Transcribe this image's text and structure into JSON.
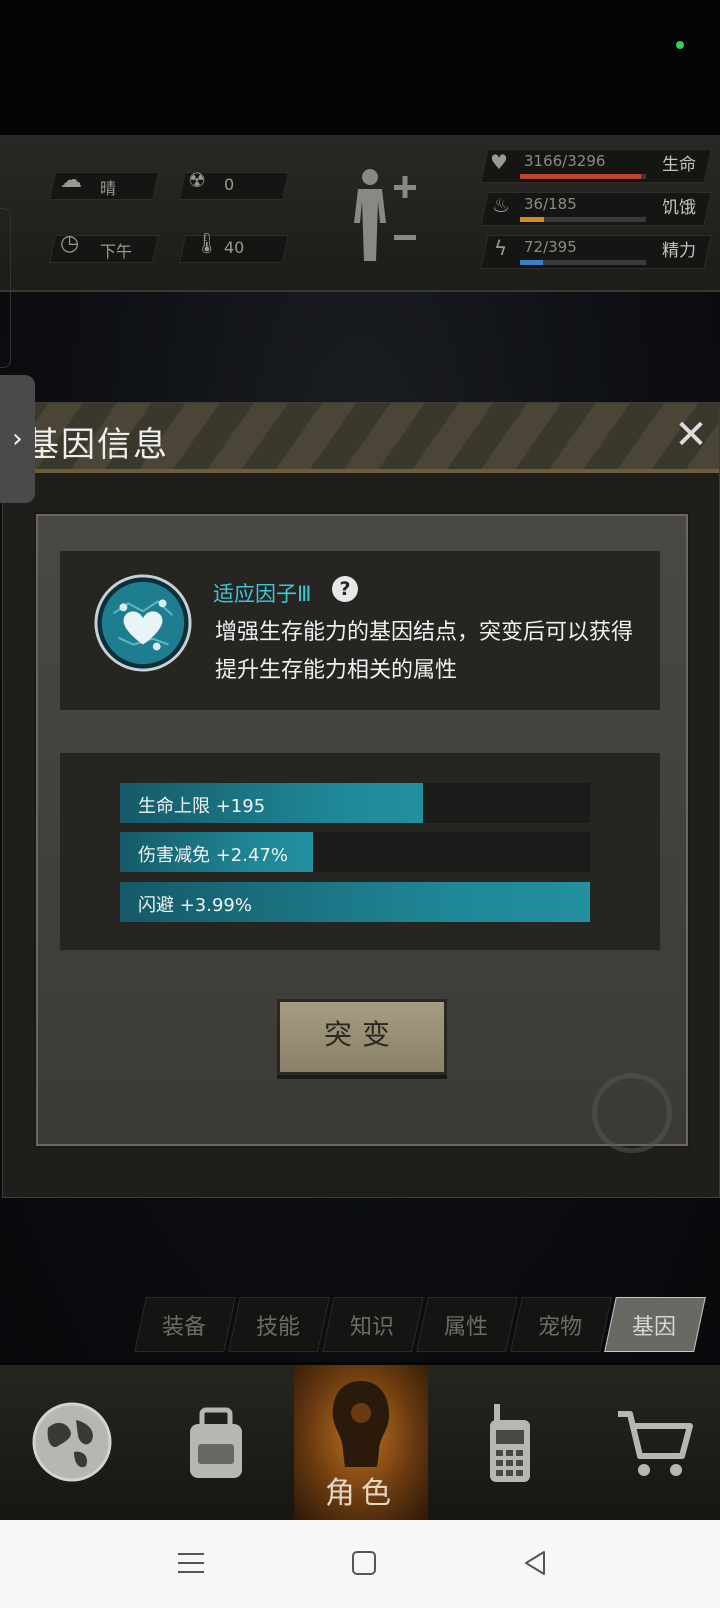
{
  "status": {
    "weather": "晴",
    "radiation": "0",
    "time": "下午",
    "temperature": "40",
    "stats": [
      {
        "name": "生命",
        "value": "3166/3296",
        "fraction": 0.96,
        "color": "#c0412e"
      },
      {
        "name": "饥饿",
        "value": "36/185",
        "fraction": 0.19,
        "color": "#d18a2a"
      },
      {
        "name": "精力",
        "value": "72/395",
        "fraction": 0.18,
        "color": "#3a7fc8"
      }
    ]
  },
  "dialog": {
    "title": "基因信息",
    "gene": {
      "name": "适应因子Ⅲ",
      "help": "?",
      "description_lines": [
        "增强生存能力的基因结点，突变后可以获得",
        "提升生存能力相关的属性"
      ]
    },
    "attributes": [
      {
        "label": "生命上限 +195",
        "fraction": 0.645
      },
      {
        "label": "伤害减免 +2.47%",
        "fraction": 0.41
      },
      {
        "label": "闪避 +3.99%",
        "fraction": 1.0
      }
    ],
    "mutate_label": "突变"
  },
  "tabs": [
    {
      "label": "装备",
      "active": false
    },
    {
      "label": "技能",
      "active": false
    },
    {
      "label": "知识",
      "active": false
    },
    {
      "label": "属性",
      "active": false
    },
    {
      "label": "宠物",
      "active": false
    },
    {
      "label": "基因",
      "active": true
    }
  ],
  "nav": {
    "items": [
      "globe-icon",
      "backpack-icon",
      "character-icon",
      "radio-icon",
      "cart-icon"
    ],
    "active_label": "角色"
  }
}
